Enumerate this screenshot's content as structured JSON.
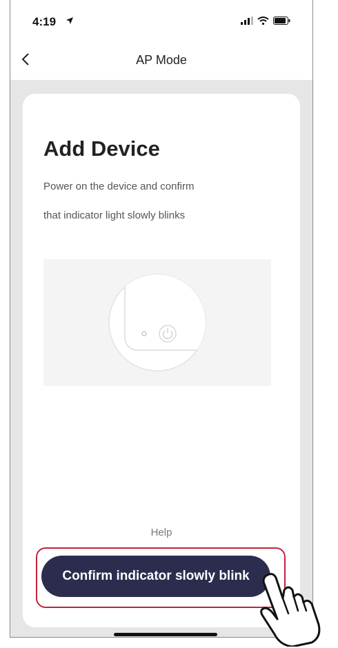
{
  "status_bar": {
    "time": "4:19"
  },
  "nav": {
    "title": "AP Mode"
  },
  "card": {
    "title": "Add Device",
    "description_line1": "Power on the device and confirm",
    "description_line2": "that indicator light slowly blinks"
  },
  "help": {
    "label": "Help"
  },
  "confirm_button": {
    "label": "Confirm indicator slowly blink"
  },
  "colors": {
    "button": "#2c2d4e",
    "highlight": "#c3233a",
    "page_background": "#e6e6e6"
  },
  "icons": [
    "location-arrow-icon",
    "signal-icon",
    "wifi-icon",
    "battery-icon",
    "back-chevron-icon",
    "device-illustration",
    "power-icon",
    "pointing-hand-icon"
  ]
}
